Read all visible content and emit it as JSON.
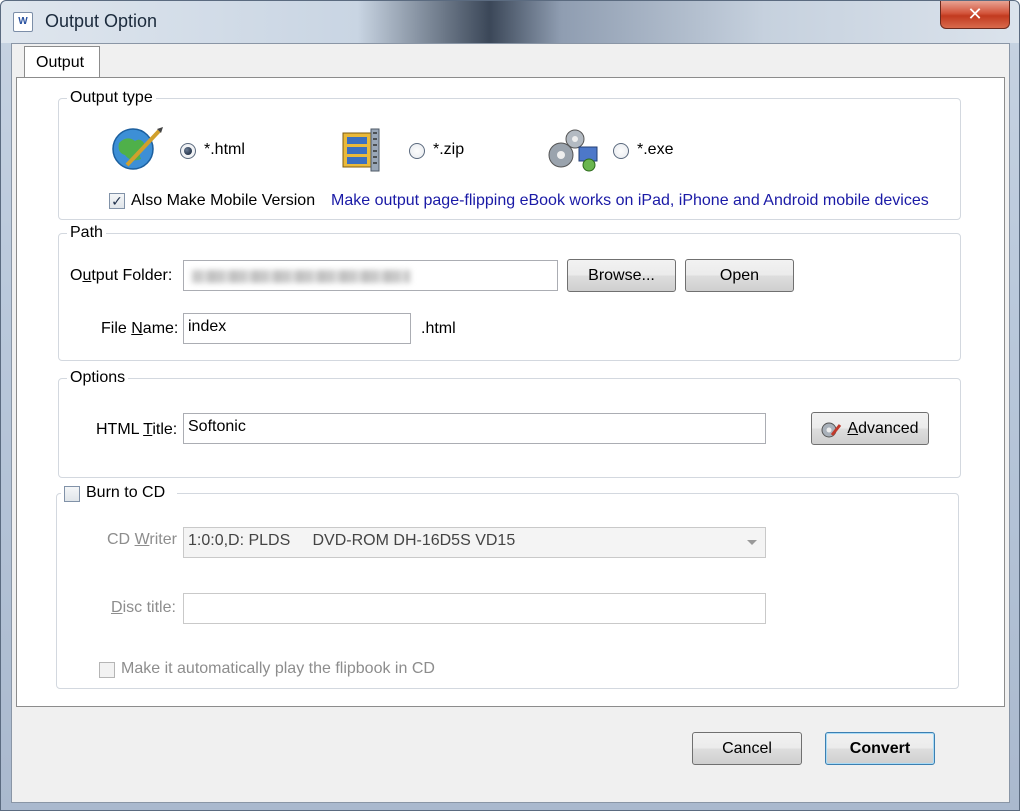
{
  "window": {
    "title": "Output Option",
    "close_glyph": "✕"
  },
  "tabs": {
    "output": "Output"
  },
  "output_type": {
    "legend": "Output type",
    "html_label": "*.html",
    "zip_label": "*.zip",
    "exe_label": "*.exe",
    "selected": "html",
    "mobile_label": "Also Make Mobile Version",
    "mobile_checked": true,
    "mobile_hint": "Make output page-flipping eBook works on iPad, iPhone and Android mobile devices"
  },
  "path": {
    "legend": "Path",
    "output_folder_label_pre": "O",
    "output_folder_label_u": "u",
    "output_folder_label_post": "tput Folder:",
    "browse_label": "Browse...",
    "open_label": "Open",
    "file_name_label_pre": "File ",
    "file_name_label_u": "N",
    "file_name_label_post": "ame:",
    "file_name_value": "index",
    "file_ext": ".html"
  },
  "options": {
    "legend": "Options",
    "html_title_label_pre": "HTML ",
    "html_title_label_u": "T",
    "html_title_label_post": "itle:",
    "html_title_value": "Softonic",
    "advanced_label_u": "A",
    "advanced_label_post": "dvanced"
  },
  "burn": {
    "legend": "Burn to CD",
    "checked": false,
    "cd_writer_label_pre": "CD ",
    "cd_writer_label_u": "W",
    "cd_writer_label_post": "riter",
    "cd_writer_value": "1:0:0,D: PLDS     DVD-ROM DH-16D5S VD15",
    "disc_title_label_u": "D",
    "disc_title_label_post": "isc title:",
    "disc_title_value": "",
    "autoplay_label": "Make it automatically play the flipbook in CD"
  },
  "footer": {
    "cancel_label": "Cancel",
    "convert_label": "Convert"
  }
}
